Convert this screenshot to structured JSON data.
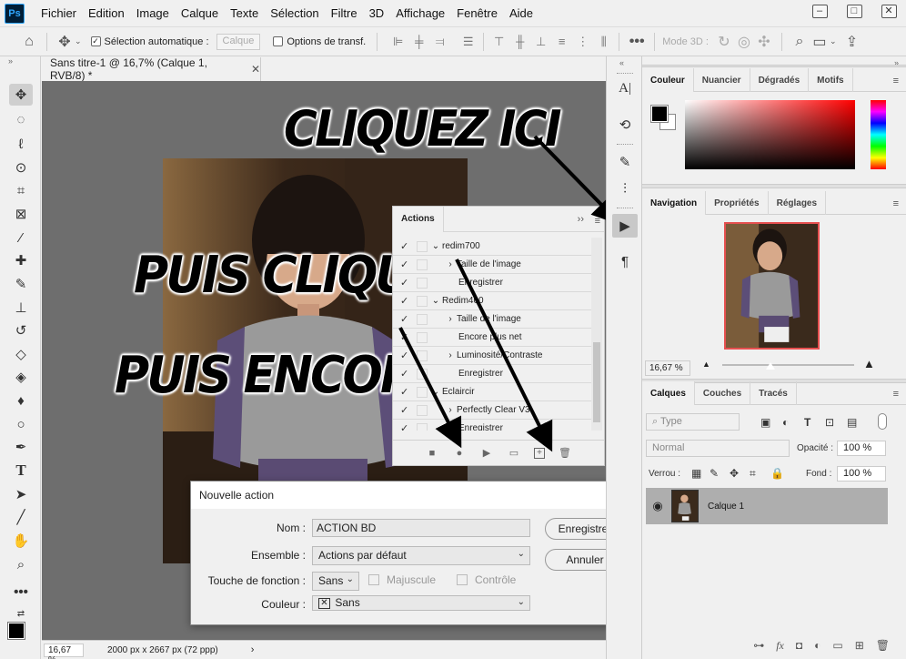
{
  "app": {
    "logo_text": "Ps"
  },
  "menubar": {
    "items": [
      "Fichier",
      "Edition",
      "Image",
      "Calque",
      "Texte",
      "Sélection",
      "Filtre",
      "3D",
      "Affichage",
      "Fenêtre",
      "Aide"
    ]
  },
  "window_controls": {
    "minimize": "–",
    "maximize": "□",
    "close": "✕"
  },
  "options_bar": {
    "auto_select_label": "Sélection automatique :",
    "auto_select_checked": true,
    "auto_select_value": "Calque",
    "transform_label": "Options de transf.",
    "transform_checked": false,
    "mode3d_label": "Mode 3D :"
  },
  "document": {
    "tab_title": "Sans titre-1 @ 16,7% (Calque 1, RVB/8) *",
    "zoom": "16,67 %",
    "info": "2000 px x 2667 px (72 ppp)"
  },
  "annotations": {
    "first": "CLIQUEZ ICI",
    "second": "PUIS CLIQUEZ ICI",
    "third": "PUIS ENCORE LÀ"
  },
  "actions_panel": {
    "title": "Actions",
    "rows": [
      {
        "check": "✓",
        "twisty": "⌄",
        "label": "redim700",
        "indent": 0
      },
      {
        "check": "✓",
        "twisty": "›",
        "label": "Taille de l'image",
        "indent": 1
      },
      {
        "check": "✓",
        "twisty": "",
        "label": "Enregistrer",
        "indent": 1
      },
      {
        "check": "✓",
        "twisty": "⌄",
        "label": "Redim400",
        "indent": 0
      },
      {
        "check": "✓",
        "twisty": "›",
        "label": "Taille de l'image",
        "indent": 1
      },
      {
        "check": "✓",
        "twisty": "",
        "label": "Encore plus net",
        "indent": 1
      },
      {
        "check": "✓",
        "twisty": "›",
        "label": "Luminosité/Contraste",
        "indent": 1
      },
      {
        "check": "✓",
        "twisty": "",
        "label": "Enregistrer",
        "indent": 1
      },
      {
        "check": "✓",
        "twisty": "⌄",
        "label": "Eclaircir",
        "indent": 0
      },
      {
        "check": "✓",
        "twisty": "›",
        "label": "Perfectly Clear V3",
        "indent": 1
      },
      {
        "check": "✓",
        "twisty": "",
        "label": "Enregistrer",
        "indent": 1
      }
    ]
  },
  "dialog": {
    "title": "Nouvelle action",
    "name_label": "Nom :",
    "name_value": "ACTION BD",
    "set_label": "Ensemble :",
    "set_value": "Actions par défaut",
    "fkey_label": "Touche de fonction :",
    "fkey_value": "Sans",
    "shift_label": "Majuscule",
    "control_label": "Contrôle",
    "color_label": "Couleur :",
    "color_value": "Sans",
    "record_button": "Enregistrer",
    "cancel_button": "Annuler"
  },
  "color_panel": {
    "tabs": [
      "Couleur",
      "Nuancier",
      "Dégradés",
      "Motifs"
    ],
    "foreground": "#000000",
    "background": "#ffffff"
  },
  "navigator_panel": {
    "tabs": [
      "Navigation",
      "Propriétés",
      "Réglages"
    ],
    "zoom": "16,67 %"
  },
  "layers_panel": {
    "tabs": [
      "Calques",
      "Couches",
      "Tracés"
    ],
    "filter_placeholder": "Type",
    "blend_mode": "Normal",
    "opacity_label": "Opacité :",
    "opacity_value": "100 %",
    "lock_label": "Verrou :",
    "fill_label": "Fond :",
    "fill_value": "100 %",
    "layer_name": "Calque 1"
  }
}
